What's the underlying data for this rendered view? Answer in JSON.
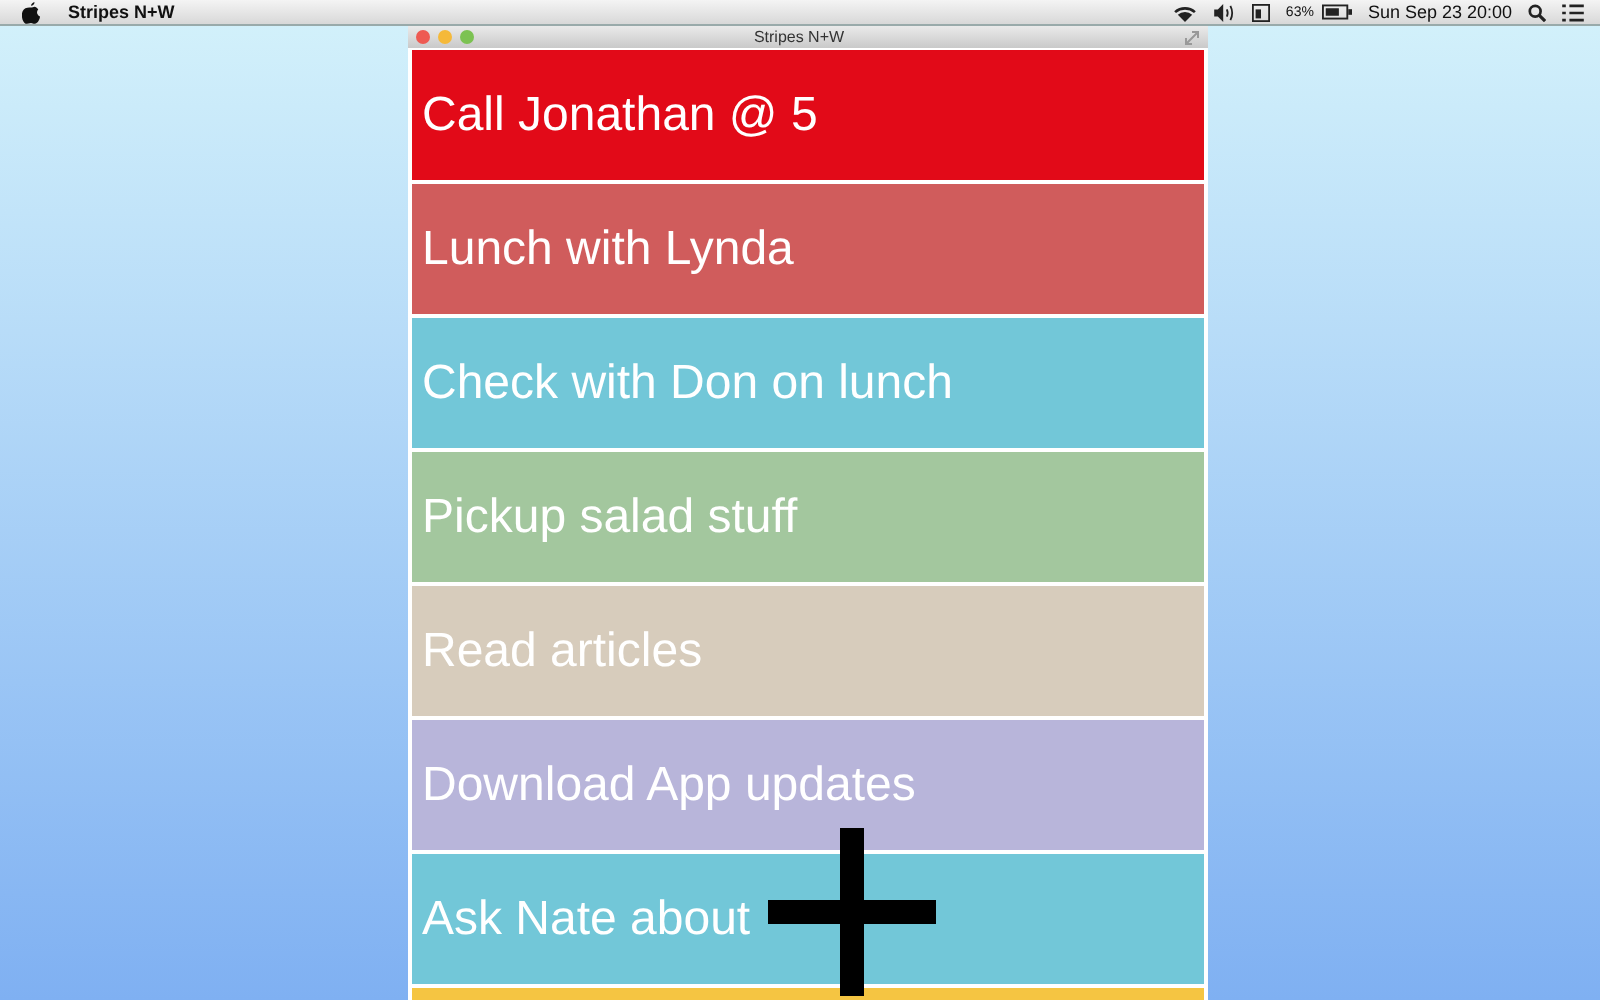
{
  "menu_bar": {
    "app_name": "Stripes N+W",
    "battery": "63%",
    "clock": "Sun Sep 23  20:00"
  },
  "window": {
    "title": "Stripes N+W"
  },
  "stripes": [
    {
      "text": "Call Jonathan @ 5",
      "color": "#e20a18"
    },
    {
      "text": "Lunch with Lynda",
      "color": "#d05c5c"
    },
    {
      "text": "Check with Don on lunch",
      "color": "#72c7d8"
    },
    {
      "text": "Pickup salad stuff",
      "color": "#a3c79e"
    },
    {
      "text": "Read articles",
      "color": "#d7ccbc"
    },
    {
      "text": "Download App updates",
      "color": "#b8b5da"
    },
    {
      "text": "Ask Nate about",
      "color": "#72c7d8"
    },
    {
      "color": "#f5c542"
    }
  ]
}
